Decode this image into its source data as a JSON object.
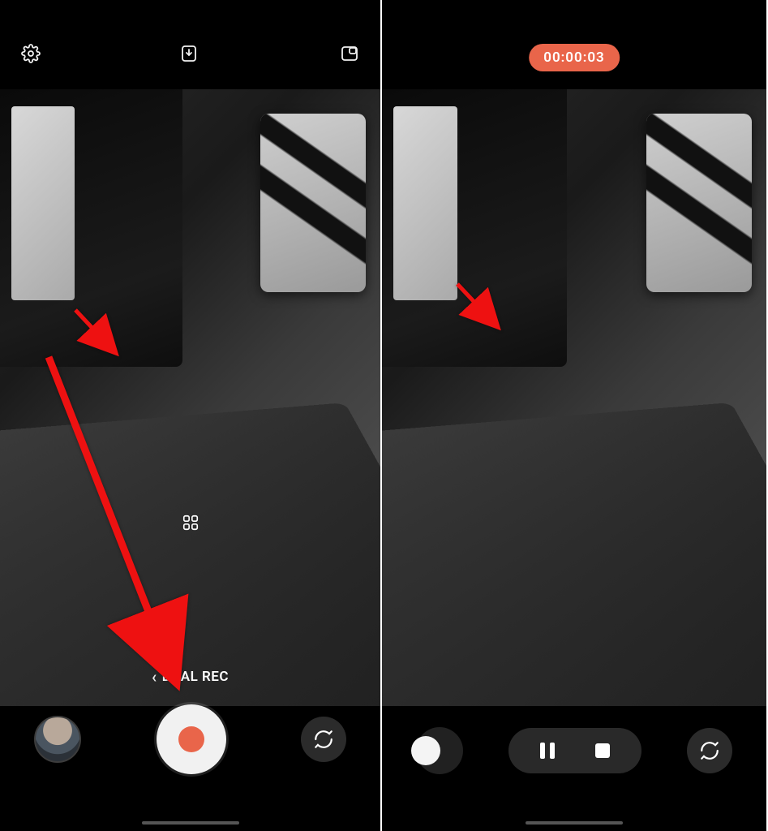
{
  "left": {
    "mode_label": "DUAL REC",
    "icons": {
      "settings": "settings-icon",
      "save": "save-icon",
      "pip_layout": "pip-layout-icon",
      "switch_camera": "switch-camera-icon"
    }
  },
  "right": {
    "timer": "00:00:03",
    "icons": {
      "pause": "pause-icon",
      "stop": "stop-icon",
      "switch_camera": "switch-camera-icon"
    }
  },
  "colors": {
    "accent": "#e9654a",
    "shutter_bg": "#f1f1f1"
  }
}
